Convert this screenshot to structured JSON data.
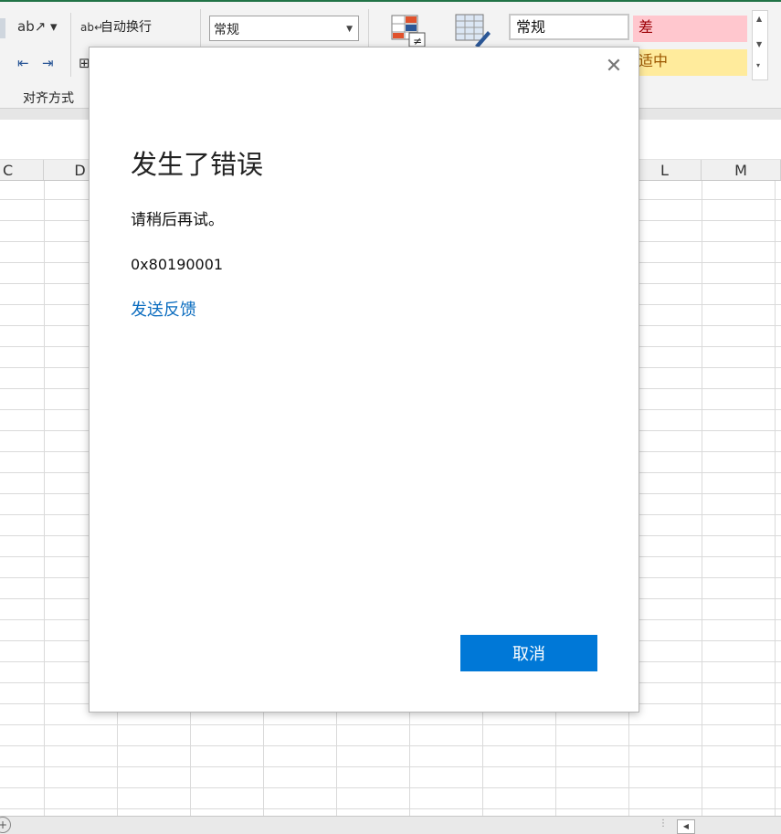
{
  "ribbon": {
    "wrap_text_icon": "wrap-text-icon",
    "wrap_text_label": "自动换行",
    "alignment_group_label": "对齐方式",
    "number_format_value": "常规",
    "styles": {
      "normal": "常规",
      "bad": "差",
      "neutral": "适中"
    }
  },
  "columns": [
    "C",
    "D",
    "L",
    "M"
  ],
  "dialog": {
    "title": "发生了错误",
    "message": "请稍后再试。",
    "error_code": "0x80190001",
    "feedback_link": "发送反馈",
    "cancel_button": "取消",
    "close_icon": "close-icon"
  },
  "colors": {
    "accent": "#0078d7",
    "link": "#0a6cbf",
    "bad_fill": "#ffc7ce",
    "neutral_fill": "#ffeb9c"
  }
}
